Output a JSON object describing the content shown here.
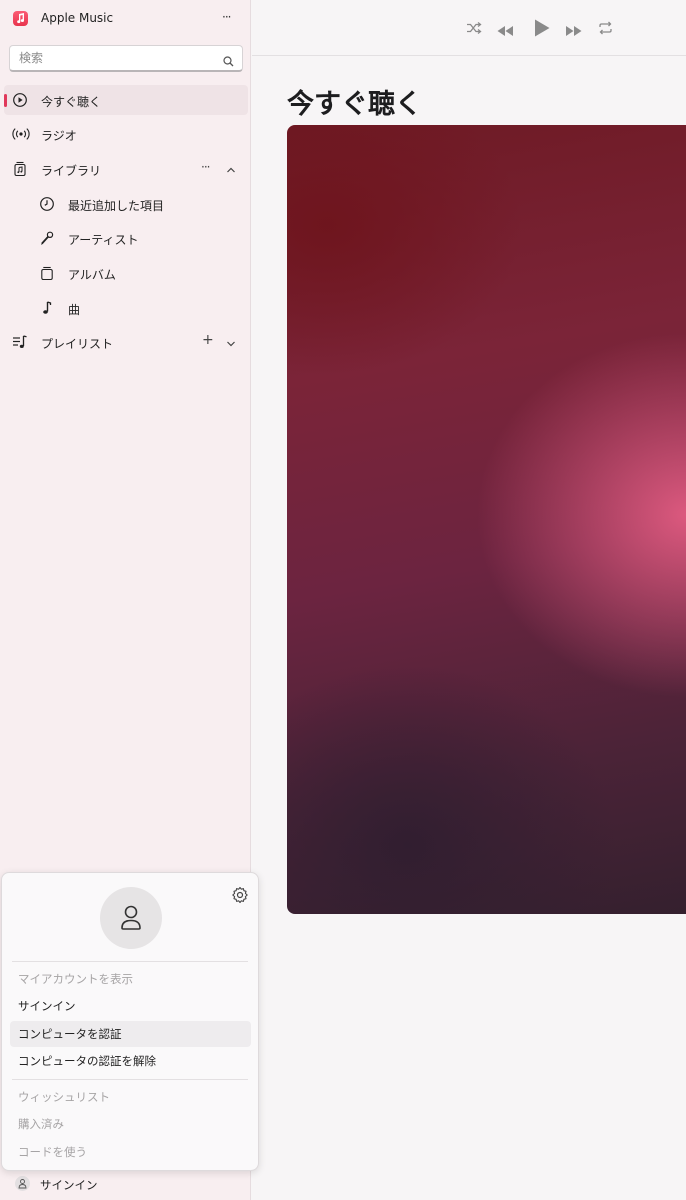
{
  "app": {
    "title": "Apple Music",
    "more": "···"
  },
  "search": {
    "placeholder": "検索"
  },
  "nav": {
    "listen_now": "今すぐ聴く",
    "radio": "ラジオ",
    "library": "ライブラリ",
    "library_more": "···",
    "recently_added": "最近追加した項目",
    "artists": "アーティスト",
    "albums": "アルバム",
    "songs": "曲",
    "playlists": "プレイリスト",
    "playlists_add": "+"
  },
  "main": {
    "title": "今すぐ聴く"
  },
  "account_menu": {
    "view_account": "マイアカウントを表示",
    "sign_in": "サインイン",
    "authorize": "コンピュータを認証",
    "deauthorize": "コンピュータの認証を解除",
    "wishlist": "ウィッシュリスト",
    "purchased": "購入済み",
    "redeem": "コードを使う"
  },
  "footer": {
    "sign_in": "サインイン"
  },
  "colors": {
    "accent": "#e0385a",
    "sidebar_bg": "#f8eef0"
  }
}
